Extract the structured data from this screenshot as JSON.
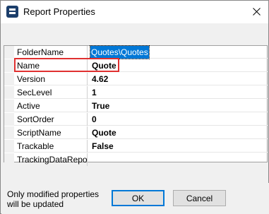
{
  "window": {
    "title": "Report Properties",
    "icon": "report-app-icon",
    "close_icon": "close-icon"
  },
  "properties": [
    {
      "name": "FolderName",
      "value": "Quotes\\Quotes",
      "selected": true
    },
    {
      "name": "Name",
      "value": "Quote",
      "selected": false
    },
    {
      "name": "Version",
      "value": "4.62",
      "selected": false
    },
    {
      "name": "SecLevel",
      "value": "1",
      "selected": false
    },
    {
      "name": "Active",
      "value": "True",
      "selected": false
    },
    {
      "name": "SortOrder",
      "value": "0",
      "selected": false
    },
    {
      "name": "ScriptName",
      "value": "Quote",
      "selected": false
    },
    {
      "name": "Trackable",
      "value": "False",
      "selected": false
    },
    {
      "name": "TrackingDataReport",
      "value": "",
      "selected": false
    }
  ],
  "footer": {
    "note": "Only modified properties will be updated",
    "ok_label": "OK",
    "cancel_label": "Cancel"
  },
  "colors": {
    "selection": "#0078d7",
    "highlight_box": "#e03030"
  }
}
